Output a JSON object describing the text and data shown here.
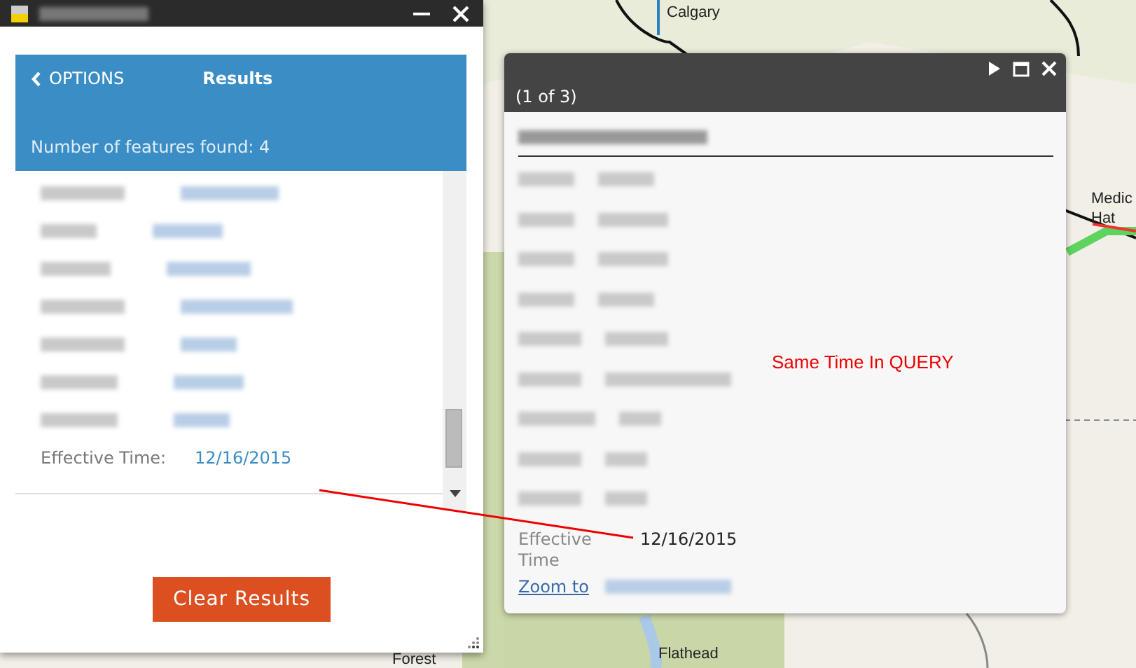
{
  "map": {
    "labels": [
      {
        "text": "Calgary"
      },
      {
        "text": "Medic"
      },
      {
        "text": "Hat"
      },
      {
        "text": "Flathead"
      },
      {
        "text": "Forest"
      }
    ]
  },
  "results_panel": {
    "back_link": "OPTIONS",
    "title": "Results",
    "features_label": "Number of features found: ",
    "features_count": "4",
    "field": {
      "label": "Effective Time:",
      "value": "12/16/2015"
    },
    "button": "Clear Results"
  },
  "popup": {
    "counter": "(1 of 3)",
    "field": {
      "label": "Effective Time",
      "value": "12/16/2015"
    },
    "zoom_link": "Zoom to"
  },
  "annotation": {
    "text": "Same Time In QUERY"
  }
}
